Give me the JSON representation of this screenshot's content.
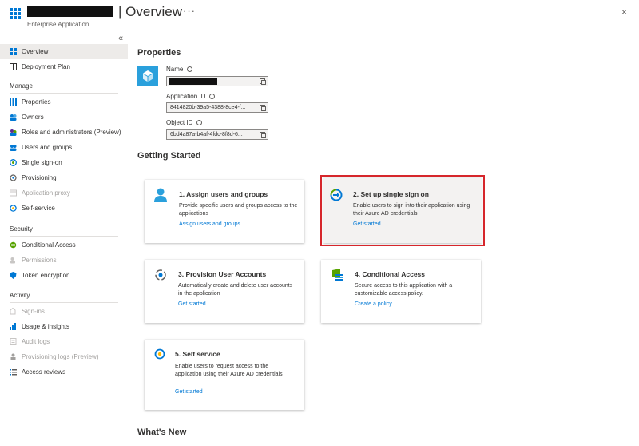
{
  "header": {
    "title": "| Overview",
    "subtitle": "Enterprise Application",
    "more": "···",
    "close": "×"
  },
  "sidebar": {
    "collapse": "«",
    "top_items": [
      {
        "label": "Overview",
        "icon": "overview-icon",
        "selected": true
      },
      {
        "label": "Deployment Plan",
        "icon": "book-icon"
      }
    ],
    "sections": [
      {
        "title": "Manage",
        "items": [
          {
            "label": "Properties",
            "icon": "properties-icon"
          },
          {
            "label": "Owners",
            "icon": "owners-icon"
          },
          {
            "label": "Roles and administrators (Preview)",
            "icon": "roles-icon"
          },
          {
            "label": "Users and groups",
            "icon": "users-groups-icon"
          },
          {
            "label": "Single sign-on",
            "icon": "sso-icon"
          },
          {
            "label": "Provisioning",
            "icon": "provisioning-icon"
          },
          {
            "label": "Application proxy",
            "icon": "app-proxy-icon",
            "disabled": true
          },
          {
            "label": "Self-service",
            "icon": "self-service-icon"
          }
        ]
      },
      {
        "title": "Security",
        "items": [
          {
            "label": "Conditional Access",
            "icon": "conditional-access-icon"
          },
          {
            "label": "Permissions",
            "icon": "permissions-icon",
            "disabled": true
          },
          {
            "label": "Token encryption",
            "icon": "shield-icon"
          }
        ]
      },
      {
        "title": "Activity",
        "items": [
          {
            "label": "Sign-ins",
            "icon": "sign-ins-icon",
            "disabled": true
          },
          {
            "label": "Usage & insights",
            "icon": "insights-icon"
          },
          {
            "label": "Audit logs",
            "icon": "audit-logs-icon",
            "disabled": true
          },
          {
            "label": "Provisioning logs (Preview)",
            "icon": "provisioning-logs-icon",
            "disabled": true
          },
          {
            "label": "Access reviews",
            "icon": "access-reviews-icon"
          }
        ]
      }
    ]
  },
  "properties": {
    "heading": "Properties",
    "name_label": "Name",
    "app_id_label": "Application ID",
    "app_id_value": "8414820b-39a5-4388-8ce4-f...",
    "object_id_label": "Object ID",
    "object_id_value": "6bd4a87a-b4af-4fdc-8f8d-6..."
  },
  "getting_started": {
    "heading": "Getting Started",
    "cards": [
      {
        "title": "1. Assign users and groups",
        "desc": "Provide specific users and groups access to the applications",
        "link": "Assign users and groups"
      },
      {
        "title": "2. Set up single sign on",
        "desc": "Enable users to sign into their application using their Azure AD credentials",
        "link": "Get started"
      },
      {
        "title": "3. Provision User Accounts",
        "desc": "Automatically create and delete user accounts in the application",
        "link": "Get started"
      },
      {
        "title": "4. Conditional Access",
        "desc": "Secure access to this application with a customizable access policy.",
        "link": "Create a policy"
      },
      {
        "title": "5. Self service",
        "desc": "Enable users to request access to the application using their Azure AD credentials",
        "link": "Get started"
      }
    ]
  },
  "whats_new": {
    "heading": "What's New"
  },
  "colors": {
    "accent": "#0078d4",
    "highlight": "#d6262b",
    "selected_bg": "#edebe9"
  }
}
